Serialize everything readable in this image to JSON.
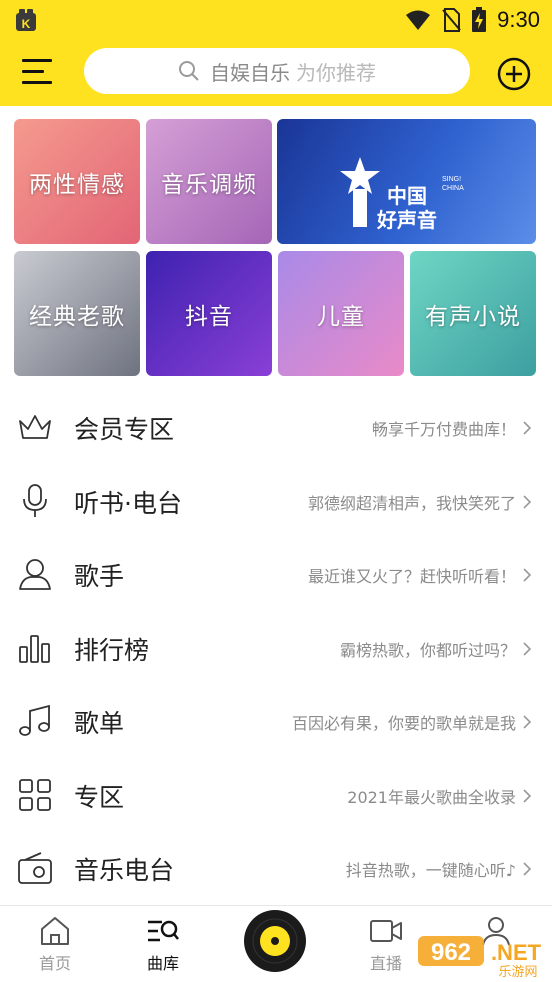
{
  "status_bar": {
    "time": "9:30"
  },
  "search": {
    "app_name": "自娱自乐",
    "hint": "为你推荐"
  },
  "tiles": [
    {
      "label": "两性情感",
      "colors": [
        "#F08C82",
        "#E46773"
      ]
    },
    {
      "label": "音乐调频",
      "colors": [
        "#C98FCB",
        "#A869B8"
      ]
    },
    {
      "label": "",
      "colors": [
        "#1E3FA8",
        "#3B6FD9"
      ],
      "logo_main": "中国",
      "logo_sub": "好声音",
      "logo_en1": "SING!",
      "logo_en2": "CHINA"
    },
    {
      "label": "经典老歌",
      "colors": [
        "#B7B9C0",
        "#7E8290"
      ]
    },
    {
      "label": "抖音",
      "colors": [
        "#5A2FC2",
        "#7C3CD0"
      ]
    },
    {
      "label": "儿童",
      "colors": [
        "#B98DE6",
        "#E37FC9"
      ]
    },
    {
      "label": "有声小说",
      "colors": [
        "#58C8B8",
        "#3FA7A3"
      ]
    }
  ],
  "menu": [
    {
      "title": "会员专区",
      "subtitle": "畅享千万付费曲库！",
      "icon": "crown-icon"
    },
    {
      "title": "听书·电台",
      "subtitle": "郭德纲超清相声，我快笑死了",
      "icon": "microphone-icon"
    },
    {
      "title": "歌手",
      "subtitle": "最近谁又火了？赶快听听看！",
      "icon": "person-icon"
    },
    {
      "title": "排行榜",
      "subtitle": "霸榜热歌，你都听过吗？",
      "icon": "chart-bars-icon"
    },
    {
      "title": "歌单",
      "subtitle": "百因必有果，你要的歌单就是我",
      "icon": "music-note-icon"
    },
    {
      "title": "专区",
      "subtitle": "2021年最火歌曲全收录",
      "icon": "grid-icon"
    },
    {
      "title": "音乐电台",
      "subtitle": "抖音热歌，一键随心听♪",
      "icon": "radio-icon"
    }
  ],
  "tabs": [
    {
      "label": "首页",
      "icon": "home-icon"
    },
    {
      "label": "曲库",
      "icon": "library-search-icon"
    },
    {
      "label": "直播",
      "icon": "video-camera-icon"
    },
    {
      "label": "",
      "icon": "profile-icon"
    }
  ],
  "watermark": {
    "brand": "962",
    "suffix": ".NET",
    "site": "乐游网"
  },
  "colors": {
    "accent": "#FFE21F",
    "text": "#222222",
    "subtext": "#8B8B8B"
  }
}
